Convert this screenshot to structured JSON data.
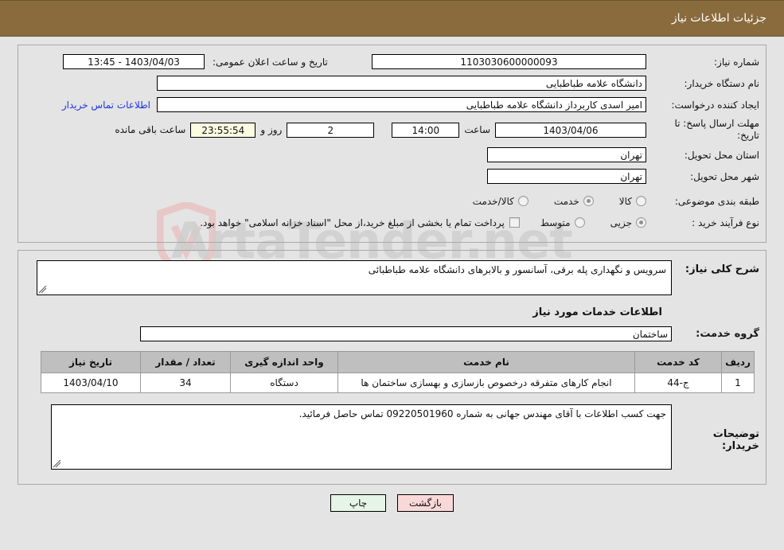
{
  "header": {
    "title": "جزئیات اطلاعات نیاز"
  },
  "watermark": {
    "text": "ArtaTender.net",
    "shield_color": "#e8c7c7"
  },
  "info": {
    "need_number_label": "شماره نیاز:",
    "need_number_value": "1103030600000093",
    "announce_label": "تاریخ و ساعت اعلان عمومی:",
    "announce_value": "1403/04/03 - 13:45",
    "buyer_org_label": "نام دستگاه خریدار:",
    "buyer_org_value": "دانشگاه علامه طباطبایی",
    "creator_label": "ایجاد کننده درخواست:",
    "creator_value": "امیر اسدی کاربرداز دانشگاه علامه طباطبایی",
    "contact_link": "اطلاعات تماس خریدار",
    "deadline_label": "مهلت ارسال پاسخ: تا تاریخ:",
    "deadline_date": "1403/04/06",
    "hour_label": "ساعت",
    "deadline_hour": "14:00",
    "days_value": "2",
    "days_label": "روز و",
    "countdown_value": "23:55:54",
    "remaining_label": "ساعت باقی مانده",
    "province_label": "استان محل تحویل:",
    "province_value": "تهران",
    "city_label": "شهر محل تحویل:",
    "city_value": "تهران",
    "category_label": "طبقه بندی موضوعی:",
    "category_options": [
      {
        "label": "کالا",
        "checked": false
      },
      {
        "label": "خدمت",
        "checked": true
      },
      {
        "label": "کالا/خدمت",
        "checked": false
      }
    ],
    "process_label": "نوع فرآیند خرید :",
    "process_options": [
      {
        "label": "جزیی",
        "checked": true
      },
      {
        "label": "متوسط",
        "checked": false
      }
    ],
    "treasury_checkbox_label": "پرداخت تمام یا بخشی از مبلغ خرید،از محل \"اسناد خزانه اسلامی\" خواهد بود.",
    "treasury_checked": false
  },
  "detail": {
    "need_desc_label": "شرح کلی نیاز:",
    "need_desc_value": "سرویس و نگهداری پله برقی، آسانسور و بالابرهای دانشگاه علامه طباطبائی",
    "services_section_title": "اطلاعات خدمات مورد نیاز",
    "service_group_label": "گروه خدمت:",
    "service_group_value": "ساختمان",
    "table": {
      "columns": [
        "ردیف",
        "کد خدمت",
        "نام خدمت",
        "واحد اندازه گیری",
        "تعداد / مقدار",
        "تاریخ نیاز"
      ],
      "rows": [
        {
          "radif": "1",
          "code": "ج-44",
          "name": "انجام کارهای متفرقه درخصوص بازسازی و بهسازی ساختمان ها",
          "unit": "دستگاه",
          "qty": "34",
          "date": "1403/04/10"
        }
      ]
    },
    "buyer_note_label": "توضیحات خریدار:",
    "buyer_note_value": "جهت کسب اطلاعات با آقای مهندس جهانی به شماره 09220501960 تماس حاصل فرمائید."
  },
  "footer": {
    "print_label": "چاپ",
    "back_label": "بازگشت"
  }
}
